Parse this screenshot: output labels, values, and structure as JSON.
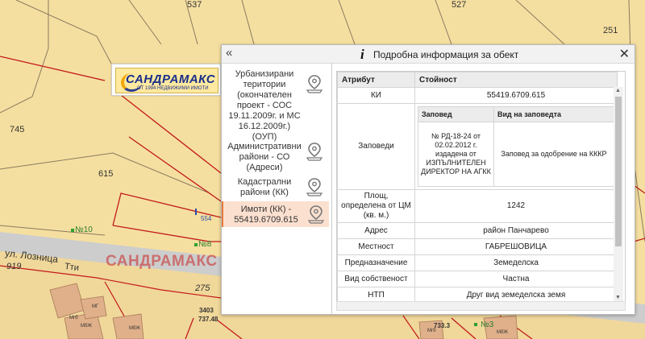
{
  "map": {
    "parcel_labels": [
      "537",
      "527",
      "251",
      "745",
      "615",
      "554",
      "№10",
      "№8",
      "919",
      "275",
      "3403",
      "737.48",
      "733.3",
      "№3"
    ],
    "street_name": "ул. Лозница",
    "street_suffix": "Тти",
    "building_labels": [
      "Мгб",
      "МбЖ",
      "МбЖ",
      "МбЖ",
      "МГ",
      "Мгб"
    ],
    "logo_text": "САНДРАМАКС",
    "logo_tagline": "ОТ 1994 НЕДВИЖИМИ ИМОТИ",
    "watermark": "САНДРАМАКС ЕООД",
    "colors": {
      "land": "#f5dfa0",
      "road": "#c8c8c8",
      "parcel_line": "#c21a1a",
      "building": "#e0b08a"
    }
  },
  "panel": {
    "collapse_label": "«",
    "info_icon": "i",
    "title": "Подробна информация за обект",
    "close_label": "✕",
    "layers": [
      {
        "label": "Урбанизирани територии (окончателен проект - СОС 19.11.2009г. и МС 16.12.2009г.) (ОУП)",
        "icon": "map-pin-icon",
        "active": false
      },
      {
        "label": "Административни райони - СО (Адреси)",
        "icon": "map-pin-icon",
        "active": false
      },
      {
        "label": "Кадастрални райони (КК)",
        "icon": "map-pin-icon",
        "active": false
      },
      {
        "label": "Имоти (КК) - 55419.6709.615",
        "icon": "map-pin-icon",
        "active": true
      }
    ],
    "table": {
      "headers": [
        "Атрибут",
        "Стойност"
      ],
      "rows": [
        {
          "attr": "КИ",
          "value": "55419.6709.615"
        },
        {
          "attr": "Заповеди",
          "orders": {
            "headers": [
              "Заповед",
              "Вид на заповедта"
            ],
            "rows": [
              {
                "order": "№ РД-18-24 от 02.02.2012 г. издадена от ИЗПЪЛНИТЕЛЕН ДИРЕКТОР НА АГКК",
                "type": "Заповед за одобрение на КККР"
              }
            ]
          }
        },
        {
          "attr": "Площ, определена от ЦМ (кв. м.)",
          "value": "1242"
        },
        {
          "attr": "Адрес",
          "value": "район Панчарево"
        },
        {
          "attr": "Местност",
          "value": "ГАБРЕШОВИЦА"
        },
        {
          "attr": "Предназначение",
          "value": "Земеделска"
        },
        {
          "attr": "Вид собственост",
          "value": "Частна"
        },
        {
          "attr": "НТП",
          "value": "Друг вид земеделска земя"
        }
      ]
    }
  }
}
